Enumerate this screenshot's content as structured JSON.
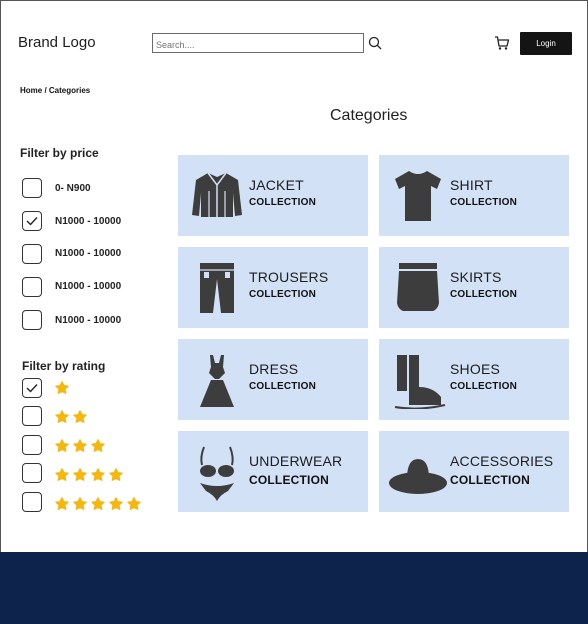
{
  "header": {
    "brand": "Brand Logo",
    "search_placeholder": "Search....",
    "login_label": "Login"
  },
  "breadcrumb": "Home / Categories",
  "page_title": "Categories",
  "filters": {
    "price_title": "Filter by price",
    "price_options": [
      {
        "label": "0- N900",
        "checked": false
      },
      {
        "label": "N1000 - 10000",
        "checked": true
      },
      {
        "label": "N1000 - 10000",
        "checked": false
      },
      {
        "label": "N1000 - 10000",
        "checked": false
      },
      {
        "label": "N1000 - 10000",
        "checked": false
      }
    ],
    "rating_title": "Filter by rating",
    "rating_options": [
      {
        "stars": 1,
        "checked": true
      },
      {
        "stars": 2,
        "checked": false
      },
      {
        "stars": 3,
        "checked": false
      },
      {
        "stars": 4,
        "checked": false
      },
      {
        "stars": 5,
        "checked": false
      }
    ]
  },
  "categories": [
    {
      "name": "JACKET",
      "sub": "COLLECTION",
      "icon": "jacket-icon"
    },
    {
      "name": "SHIRT",
      "sub": "COLLECTION",
      "icon": "shirt-icon"
    },
    {
      "name": "TROUSERS",
      "sub": "COLLECTION",
      "icon": "trousers-icon"
    },
    {
      "name": "SKIRTS",
      "sub": "COLLECTION",
      "icon": "skirt-icon"
    },
    {
      "name": "DRESS",
      "sub": "COLLECTION",
      "icon": "dress-icon"
    },
    {
      "name": "SHOES",
      "sub": "COLLECTION",
      "icon": "boot-icon"
    },
    {
      "name": "UNDERWEAR",
      "sub": "COLLECTION",
      "icon": "underwear-icon"
    },
    {
      "name": "ACCESSORIES",
      "sub": "COLLECTION",
      "icon": "hat-icon"
    }
  ],
  "colors": {
    "card_bg": "#d2e1f6",
    "icon_fill": "#3d3d3d",
    "star": "#f5b70f",
    "footer": "#0e234b",
    "login_bg": "#141414"
  }
}
